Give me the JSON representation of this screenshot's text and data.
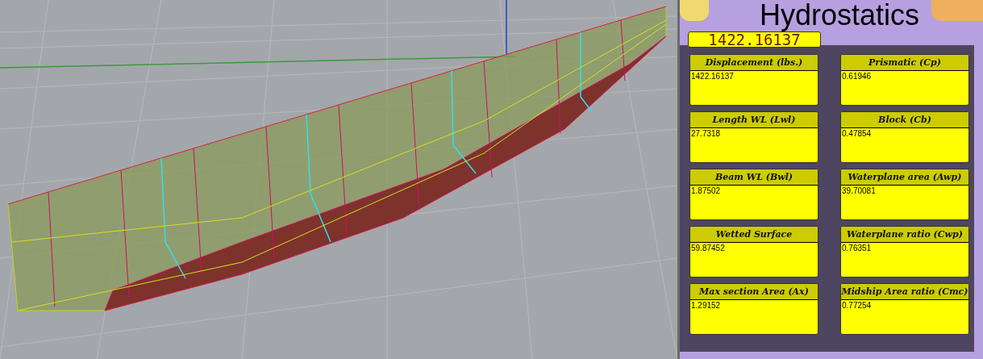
{
  "title": "Hydrostatics",
  "number_panel": {
    "value": "1422.16137"
  },
  "panels": [
    {
      "label": "Displacement (lbs.)",
      "value": "1422.16137"
    },
    {
      "label": "Prismatic (Cp)",
      "value": "0.61946"
    },
    {
      "label": "Length WL (Lwl)",
      "value": "27.7318"
    },
    {
      "label": "Block (Cb)",
      "value": "0.47854"
    },
    {
      "label": "Beam WL (Bwl)",
      "value": "1.87502"
    },
    {
      "label": "Waterplane area (Awp)",
      "value": "39.70081"
    },
    {
      "label": "Wetted Surface",
      "value": "59.87452"
    },
    {
      "label": "Waterplane ratio (Cwp)",
      "value": "0.76351"
    },
    {
      "label": "Max section Area (Ax)",
      "value": "1.29152"
    },
    {
      "label": "Midship Area ratio (Cmc)",
      "value": "0.77254"
    }
  ]
}
